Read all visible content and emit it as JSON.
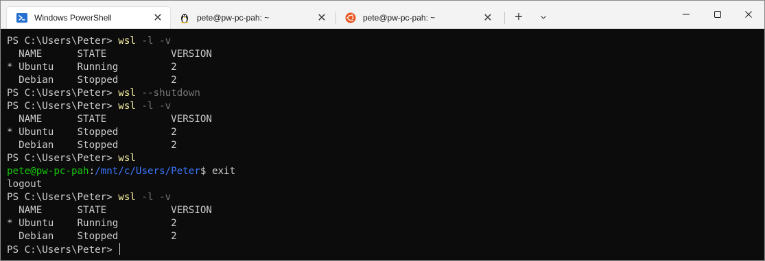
{
  "tabs": [
    {
      "title": "Windows PowerShell",
      "icon": "powershell-icon",
      "active": true
    },
    {
      "title": "pete@pw-pc-pah: ~",
      "icon": "linux-tux-icon",
      "active": false
    },
    {
      "title": "pete@pw-pc-pah: ~",
      "icon": "ubuntu-icon",
      "active": false
    }
  ],
  "controls": {
    "new_tab": "+",
    "close": "✕"
  },
  "terminal": {
    "lines": [
      [
        {
          "t": "PS C:\\Users\\Peter> "
        },
        {
          "t": "wsl",
          "c": "c-yellow"
        },
        {
          "t": " -l -v",
          "c": "c-gray"
        }
      ],
      [
        {
          "t": "  NAME      STATE           VERSION"
        }
      ],
      [
        {
          "t": "* Ubuntu    Running         2"
        }
      ],
      [
        {
          "t": "  Debian    Stopped         2"
        }
      ],
      [
        {
          "t": "PS C:\\Users\\Peter> "
        },
        {
          "t": "wsl",
          "c": "c-yellow"
        },
        {
          "t": " --shutdown",
          "c": "c-gray"
        }
      ],
      [
        {
          "t": "PS C:\\Users\\Peter> "
        },
        {
          "t": "wsl",
          "c": "c-yellow"
        },
        {
          "t": " -l -v",
          "c": "c-gray"
        }
      ],
      [
        {
          "t": "  NAME      STATE           VERSION"
        }
      ],
      [
        {
          "t": "* Ubuntu    Stopped         2"
        }
      ],
      [
        {
          "t": "  Debian    Stopped         2"
        }
      ],
      [
        {
          "t": "PS C:\\Users\\Peter> "
        },
        {
          "t": "wsl",
          "c": "c-yellow"
        }
      ],
      [
        {
          "t": "pete@pw-pc-pah",
          "c": "c-green"
        },
        {
          "t": ":"
        },
        {
          "t": "/mnt/c/Users/Peter",
          "c": "c-blue"
        },
        {
          "t": "$ exit"
        }
      ],
      [
        {
          "t": "logout"
        }
      ],
      [
        {
          "t": "PS C:\\Users\\Peter> "
        },
        {
          "t": "wsl",
          "c": "c-yellow"
        },
        {
          "t": " -l -v",
          "c": "c-gray"
        }
      ],
      [
        {
          "t": "  NAME      STATE           VERSION"
        }
      ],
      [
        {
          "t": "* Ubuntu    Running         2"
        }
      ],
      [
        {
          "t": "  Debian    Stopped         2"
        }
      ],
      [
        {
          "t": "PS C:\\Users\\Peter> "
        }
      ]
    ]
  },
  "colors": {
    "terminal_bg": "#0c0c0c",
    "text": "#cccccc",
    "command": "#f9f1a5",
    "argument": "#767676",
    "user_host": "#16c60c",
    "path": "#3b78ff",
    "powershell_blue": "#2670d0",
    "ubuntu_orange": "#e95420"
  }
}
